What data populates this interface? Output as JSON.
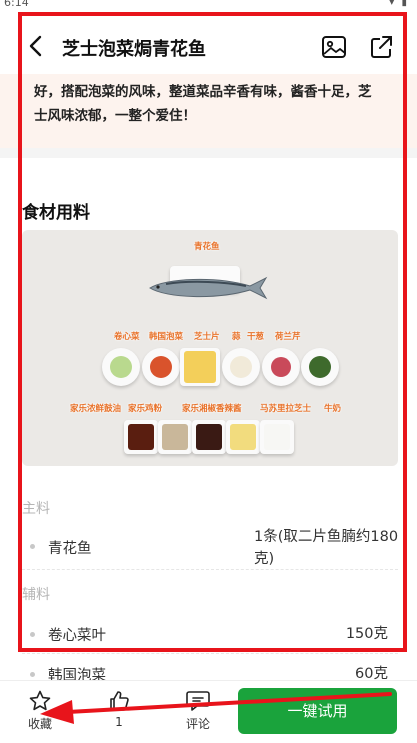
{
  "status_bar": {
    "time": "6:14"
  },
  "header": {
    "title": "芝士泡菜焗青花鱼"
  },
  "intro": {
    "text": "好，搭配泡菜的风味，整道菜品辛香有味，酱香十足，芝士风味浓郁，一整个爱住！"
  },
  "section": {
    "title": "食材用料"
  },
  "image_tags": {
    "fish": "青花鱼",
    "row1": [
      "卷心菜",
      "韩国泡菜",
      "芝士片",
      "蒜",
      "干葱",
      "荷兰芹"
    ],
    "row2": [
      "家乐浓鲜鼓油",
      "家乐鸡粉",
      "家乐湘椒香辣酱",
      "马苏里拉芝士",
      "牛奶"
    ]
  },
  "main_group": {
    "label": "主料",
    "items": [
      {
        "name": "青花鱼",
        "amount": "1条(取二片鱼腩约180克)"
      }
    ]
  },
  "aux_group": {
    "label": "辅料",
    "items": [
      {
        "name": "卷心菜叶",
        "amount": "150克"
      },
      {
        "name": "韩国泡菜",
        "amount": "60克"
      }
    ]
  },
  "bottom_bar": {
    "favorite_label": "收藏",
    "like_count": "1",
    "comment_label": "评论",
    "try_label": "一键试用"
  },
  "colors": {
    "accent_green": "#1aa33c",
    "annotation_red": "#e8141b",
    "tag_orange": "#e8722a"
  }
}
